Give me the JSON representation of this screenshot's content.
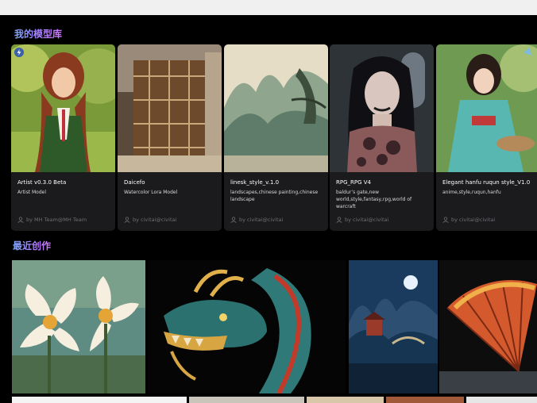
{
  "sections": {
    "models_title": "我的模型库",
    "recent_title": "最近创作"
  },
  "models": [
    {
      "name": "Artist v0.3.0 Beta",
      "tags": "Artist Model",
      "author": "by MH Team@MH Team",
      "badge": "bolt-icon"
    },
    {
      "name": "Daicefo",
      "tags": "Watercolor Lora Model",
      "author": "by civitai@civitai"
    },
    {
      "name": "linesk_style_v.1.0",
      "tags": "landscapes,chinese painting,chinese landscape",
      "author": "by civitai@civitai"
    },
    {
      "name": "RPG_RPG V4",
      "tags": "baldur’s gate,new world,style,fantasy,rpg,world of warcraft",
      "author": "by civitai@civitai"
    },
    {
      "name": "Elegant hanfu ruqun style_V1.0",
      "tags": "anime,style,ruqun,hanfu",
      "author": "by civitai@civitai"
    }
  ],
  "colors": {
    "accent_start": "#7aa8ff",
    "accent_end": "#d07bff",
    "card_bg": "#1b1b1d",
    "page_bg": "#000000"
  }
}
